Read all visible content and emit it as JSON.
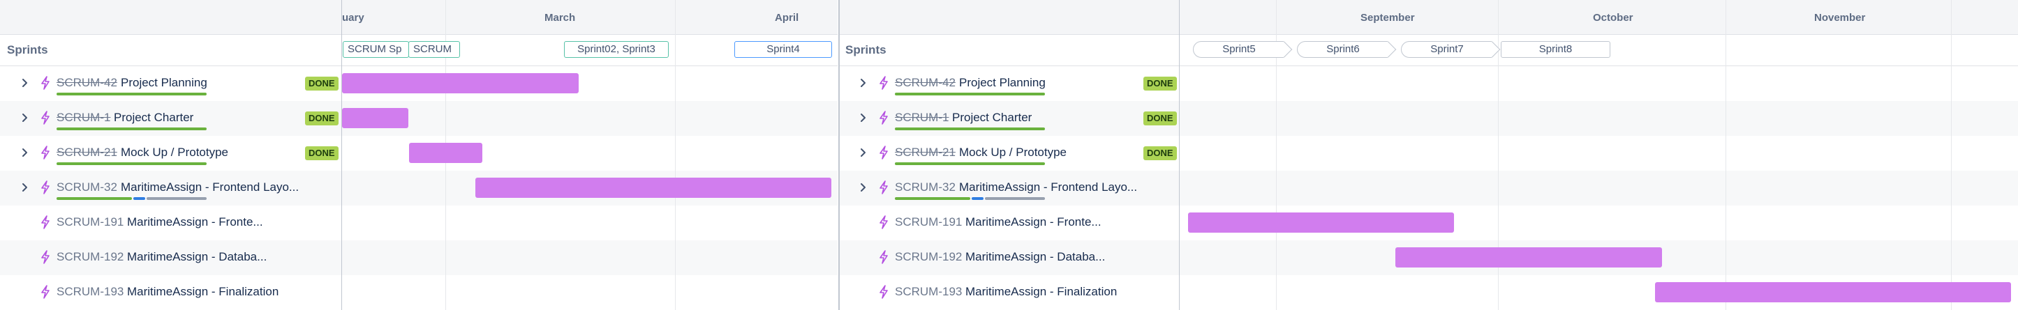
{
  "panel_left": {
    "months": [
      "uary",
      "March",
      "April"
    ],
    "sprints_label": "Sprints",
    "sprint_chips": [
      "SCRUM Sp",
      "SCRUM",
      "Sprint02, Sprint3",
      "Sprint4"
    ]
  },
  "panel_right": {
    "months": [
      "September",
      "October",
      "November"
    ],
    "sprints_label": "Sprints",
    "sprint_chips": [
      "Sprint5",
      "Sprint6",
      "Sprint7",
      "Sprint8"
    ]
  },
  "rows": [
    {
      "key": "SCRUM-42",
      "title": "Project Planning",
      "status": "DONE",
      "progress_done": 1.0
    },
    {
      "key": "SCRUM-1",
      "title": "Project Charter",
      "status": "DONE",
      "progress_done": 1.0
    },
    {
      "key": "SCRUM-21",
      "title": "Mock Up / Prototype",
      "status": "DONE",
      "progress_done": 1.0
    },
    {
      "key": "SCRUM-32",
      "title": "MaritimeAssign - Frontend Layo...",
      "status": "",
      "progress_done": 0.5,
      "progress_in_progress": 0.08
    },
    {
      "key": "SCRUM-191",
      "title": "MaritimeAssign - Fronte...",
      "status": ""
    },
    {
      "key": "SCRUM-192",
      "title": "MaritimeAssign - Databa...",
      "status": ""
    },
    {
      "key": "SCRUM-193",
      "title": "MaritimeAssign - Finalization",
      "status": ""
    }
  ],
  "icons": {
    "expand": "chevron-right-icon",
    "issue_type": "lightning-bolt-icon"
  },
  "colors": {
    "bar": "#d17dee",
    "done_badge": "#abd354",
    "progress_done": "#6ab23e",
    "progress_in_progress": "#2f7de1",
    "progress_todo": "#97a0af",
    "issue_icon": "#b450e0"
  }
}
